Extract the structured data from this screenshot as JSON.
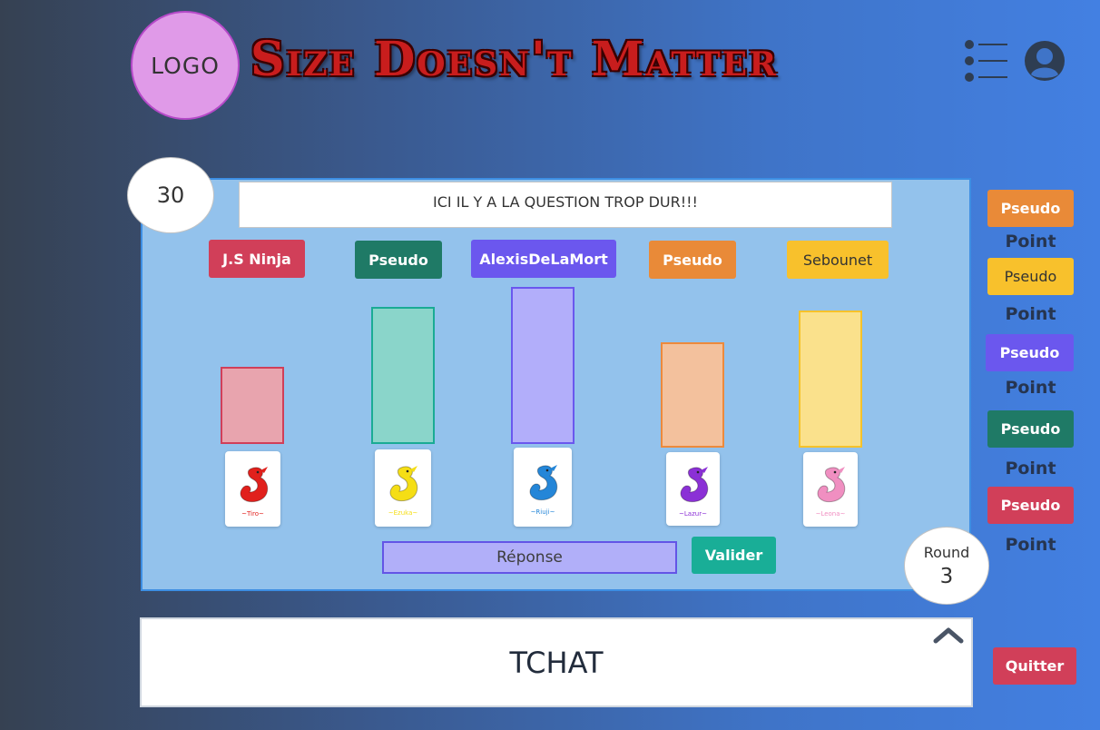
{
  "header": {
    "logo_text": "LOGO",
    "title": "Size Doesn't Matter",
    "menu_icon": "list-menu-icon",
    "user_icon": "user-profile-icon"
  },
  "game": {
    "timer": "30",
    "question": "ICI IL Y A LA QUESTION TROP DUR!!!",
    "players": [
      {
        "name": "J.S Ninja",
        "color": "#d13f59",
        "bar_color": "#e8a4ae",
        "bar_border": "#d13f59",
        "bar_level": 0.49,
        "dragon": "red-dragon-card",
        "dragon_color": "#e1201c",
        "tag": "~Tiro~"
      },
      {
        "name": "Pseudo",
        "color": "#1f7a66",
        "bar_color": "#8ad5ca",
        "bar_border": "#1aab94",
        "bar_level": 0.87,
        "dragon": "yellow-dragon-card",
        "dragon_color": "#f5de15",
        "tag": "~Ezuka~"
      },
      {
        "name": "AlexisDeLaMort",
        "color": "#6b57ee",
        "bar_color": "#b2aefa",
        "bar_border": "#6a57ee",
        "bar_level": 1.0,
        "dragon": "blue-dragon-card",
        "dragon_color": "#2486d8",
        "tag": "~Riuji~"
      },
      {
        "name": "Pseudo",
        "color": "#e98a38",
        "bar_color": "#f3c19d",
        "bar_border": "#ed8a3c",
        "bar_level": 0.67,
        "dragon": "purple-dragon-card",
        "dragon_color": "#8b30d6",
        "tag": "~Lazur~"
      },
      {
        "name": "Sebounet",
        "color": "#f8c12c",
        "bar_color": "#fae18c",
        "bar_border": "#f6c22a",
        "bar_level": 0.87,
        "dragon": "pink-dragon-card",
        "dragon_color": "#f08fc1",
        "tag": "~Leona~"
      }
    ],
    "answer_placeholder": "Réponse",
    "validate_label": "Valider",
    "round_label": "Round",
    "round_number": "3"
  },
  "scoreboard": [
    {
      "name": "Pseudo",
      "color": "#e98a38",
      "text_color": "#ffffff",
      "points_label": "Point"
    },
    {
      "name": "Pseudo",
      "color": "#f8c12c",
      "text_color": "#333333",
      "points_label": "Point"
    },
    {
      "name": "Pseudo",
      "color": "#6b57ee",
      "text_color": "#ffffff",
      "points_label": "Point"
    },
    {
      "name": "Pseudo",
      "color": "#1f7a66",
      "text_color": "#ffffff",
      "points_label": "Point"
    },
    {
      "name": "Pseudo",
      "color": "#d13f59",
      "text_color": "#ffffff",
      "points_label": "Point"
    }
  ],
  "chat": {
    "label": "TCHAT",
    "toggle_icon": "chevron-up-icon"
  },
  "quit_label": "Quitter"
}
